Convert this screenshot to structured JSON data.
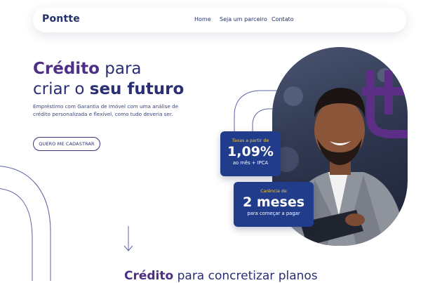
{
  "brand": {
    "logo": "Pontte"
  },
  "nav": {
    "links": [
      "Home",
      "Seja um parceiro",
      "Contato"
    ]
  },
  "hero": {
    "title_accent": "Crédito",
    "title_rest1": " para",
    "title_line2_pre": "criar o ",
    "title_line2_strong": "seu futuro",
    "description": "Empréstimo com Garantia de Imóvel com uma análise de crédito personalizada e flexível, como tudo deveria ser.",
    "cta_label": "QUERO ME CADASTRAR"
  },
  "cards": [
    {
      "label": "Taxas a partir de",
      "value": "1,09%",
      "sub": "ao mês + IPCA"
    },
    {
      "label": "Carência de",
      "value": "2 meses",
      "sub": "para começar a pagar"
    }
  ],
  "section": {
    "title_accent": "Crédito",
    "title_rest": " para concretizar planos"
  },
  "colors": {
    "navy": "#23306e",
    "purple": "#4d2f85",
    "card_blue": "#213c8a",
    "card_label_gold": "#f0c64a"
  }
}
